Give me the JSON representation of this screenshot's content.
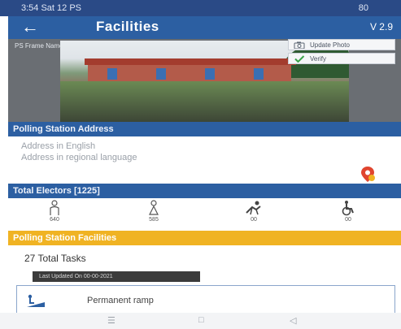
{
  "status_bar": {
    "time": "3:54 Sat 12 PS",
    "battery": "80"
  },
  "app_bar": {
    "title": "Facilities",
    "version": "V 2.9"
  },
  "photo": {
    "overlay_label": "PS Frame Name",
    "update_photo_label": "Update Photo",
    "verify_label": "Verify"
  },
  "address_section": {
    "header": "Polling Station Address",
    "line_english": "Address in English",
    "line_regional": "Address in regional language"
  },
  "electors_section": {
    "header": "Total Electors [1225]",
    "groups": [
      {
        "icon": "male-voter-icon",
        "count": "640"
      },
      {
        "icon": "female-voter-icon",
        "count": "585"
      },
      {
        "icon": "senior-voter-icon",
        "count": "00"
      },
      {
        "icon": "pwd-voter-icon",
        "count": "00"
      }
    ]
  },
  "facilities_section": {
    "header": "Polling Station Facilities",
    "total_tasks": "27 Total Tasks",
    "last_updated": "Last Updated On 00-00-2021",
    "items": [
      {
        "label": "Permanent ramp"
      }
    ]
  },
  "colors": {
    "primary": "#2c5fa2",
    "accent": "#f0b323",
    "status_bar": "#2a4a86"
  }
}
